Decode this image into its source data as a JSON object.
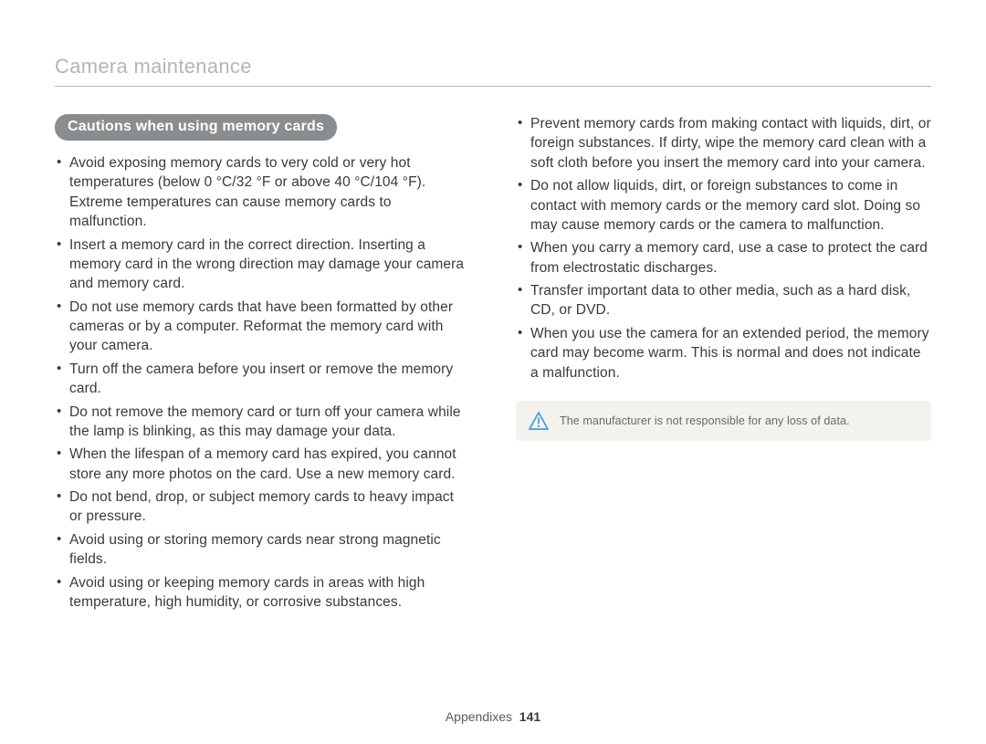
{
  "header": {
    "title": "Camera maintenance"
  },
  "section": {
    "pill_label": "Cautions when using memory cards"
  },
  "left_bullets": [
    "Avoid exposing memory cards to very cold or very hot temperatures (below 0 °C/32 °F or above 40 °C/104 °F). Extreme temperatures can cause memory cards to malfunction.",
    "Insert a memory card in the correct direction. Inserting a memory card in the wrong direction may damage your camera and memory card.",
    "Do not use memory cards that have been formatted by other cameras or by a computer. Reformat the memory card with your camera.",
    "Turn off the camera before you insert or remove the memory card.",
    "Do not remove the memory card or turn off your camera while the lamp is blinking, as this may damage your data.",
    "When the lifespan of a memory card has expired, you cannot store any more photos on the card. Use a new memory card.",
    "Do not bend, drop, or subject memory cards to heavy impact or pressure.",
    "Avoid using or storing memory cards near strong magnetic fields.",
    "Avoid using or keeping memory cards in areas with high temperature, high humidity, or corrosive substances."
  ],
  "right_bullets": [
    "Prevent memory cards from making contact with liquids, dirt, or foreign substances. If dirty, wipe the memory card clean with a soft cloth before you insert the memory card into your camera.",
    "Do not allow liquids, dirt, or foreign substances to come in contact with memory cards or the memory card slot. Doing so may cause memory cards or the camera to malfunction.",
    "When you carry a memory card, use a case to protect the card from electrostatic discharges.",
    "Transfer important data to other media, such as a hard disk, CD, or DVD.",
    "When you use the camera for an extended period, the memory card may become warm. This is normal and does not indicate a malfunction."
  ],
  "note": {
    "text": "The manufacturer is not responsible for any loss of data."
  },
  "footer": {
    "section": "Appendixes",
    "page": "141"
  }
}
